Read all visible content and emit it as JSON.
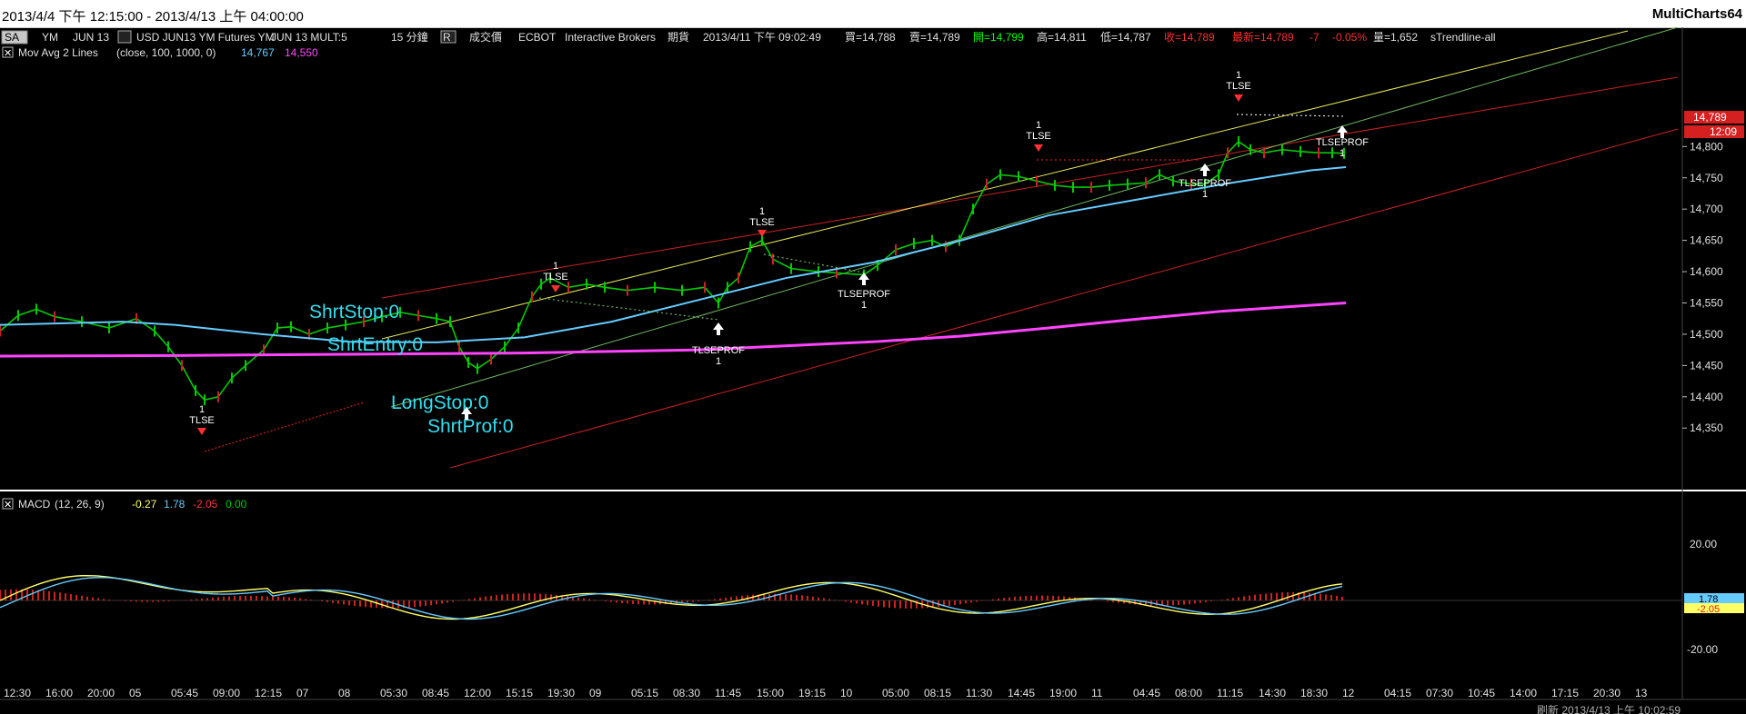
{
  "window": {
    "title": "2013/4/4 下午 12:15:00 - 2013/4/13 上午 04:00:00",
    "app": "MultiCharts64"
  },
  "status_line": {
    "sa_box": "SA",
    "symbol": "YM",
    "contract": "JUN 13",
    "description": "USD JUN13 YM Futures YM",
    "mult": "JUN 13 MULT:5",
    "interval": "15 分鐘",
    "r_box": "R",
    "data_type": "成交價",
    "exchange": "ECBOT",
    "feed": "Interactive Brokers",
    "category": "期貨",
    "datetime": "2013/4/11 下午 09:02:49",
    "bid": "買=14,788",
    "ask": "賣=14,789",
    "open": "開=14,799",
    "high": "高=14,811",
    "low": "低=14,787",
    "close": "收=14,789",
    "last": "最新=14,789",
    "change": "-7",
    "change_pct": "-0.05%",
    "volume": "量=1,652",
    "study": "sTrendline-all",
    "colors": {
      "open": "#00ff00",
      "close": "#ff3030",
      "default": "#e0e0e0"
    }
  },
  "indicator_line": {
    "name": "Mov Avg 2 Lines",
    "params": "(close,  100,  1000,  0)",
    "value1": "14,767",
    "value2": "14,550",
    "color1": "#66ccff",
    "color2": "#ff44ff"
  },
  "macd_line": {
    "name": "MACD",
    "params": "(12,  26,  9)",
    "v1": "-0.27",
    "v2": "1.78",
    "v3": "-2.05",
    "v4": "0.00",
    "colors": [
      "#ffff66",
      "#66ccff",
      "#ff3333",
      "#00cc00"
    ]
  },
  "price_axis": {
    "ticks": [
      "14,800",
      "14,750",
      "14,700",
      "14,650",
      "14,600",
      "14,550",
      "14,500",
      "14,450",
      "14,400",
      "14,350"
    ],
    "tick_values": [
      14800,
      14750,
      14700,
      14650,
      14600,
      14550,
      14500,
      14450,
      14400,
      14350
    ],
    "last_price_tag": "14,789",
    "last_price": 14789,
    "second_tag": "12:09"
  },
  "macd_axis": {
    "ticks": [
      "20.00",
      "-20.00"
    ],
    "tick_values": [
      20,
      -20
    ],
    "tag1": "1.78",
    "tag2": "-2.05"
  },
  "time_axis": {
    "labels": [
      "12:30",
      "16:00",
      "20:00",
      "05",
      "05:45",
      "09:00",
      "12:15",
      "07",
      "08",
      "05:30",
      "08:45",
      "12:00",
      "15:15",
      "19:30",
      "09",
      "05:15",
      "08:30",
      "11:45",
      "15:00",
      "19:15",
      "10",
      "05:00",
      "08:15",
      "11:30",
      "14:45",
      "19:00",
      "11",
      "04:45",
      "08:00",
      "11:15",
      "14:30",
      "18:30",
      "12",
      "04:15",
      "07:30",
      "10:45",
      "14:00",
      "17:15",
      "20:30",
      "13"
    ]
  },
  "annotations": {
    "texts": [
      "ShrtStop:0",
      "ShrtEntry:0",
      "LongStop:0",
      "ShrtProf:0"
    ],
    "markers": [
      "1",
      "TLSE",
      "TLSEPROF"
    ]
  },
  "bottom_timestamp": "刷新 2013/4/13 上午 10:02:59",
  "chart_data": {
    "type": "line",
    "title": "",
    "series": [
      {
        "name": "Mov Avg 2 Lines (100)",
        "x": [
          0,
          0.07,
          0.1,
          0.15,
          0.2,
          0.25,
          0.3,
          0.35,
          0.4,
          0.45,
          0.5,
          0.55,
          0.6,
          0.65,
          0.7,
          0.75,
          0.77
        ],
        "values": [
          14515,
          14520,
          14515,
          14500,
          14488,
          14487,
          14495,
          14520,
          14555,
          14590,
          14615,
          14650,
          14690,
          14715,
          14740,
          14762,
          14767
        ]
      },
      {
        "name": "Mov Avg 2 Lines (1000)",
        "x": [
          0,
          0.1,
          0.2,
          0.3,
          0.4,
          0.5,
          0.55,
          0.6,
          0.65,
          0.7,
          0.77
        ],
        "values": [
          14465,
          14466,
          14468,
          14470,
          14475,
          14488,
          14497,
          14510,
          14524,
          14537,
          14550
        ]
      }
    ],
    "last_price": 14789,
    "y_range": [
      14330,
      14860
    ],
    "macd": {
      "macd": -0.27,
      "signal": 1.78,
      "hist": -2.05,
      "zero": 0.0,
      "y_range": [
        -30,
        30
      ]
    }
  }
}
